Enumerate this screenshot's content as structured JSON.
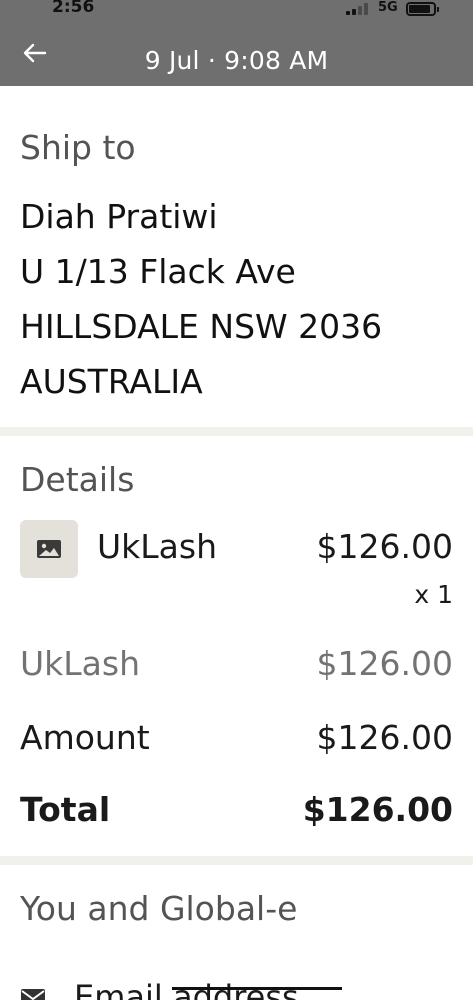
{
  "status_bar": {
    "time": "2:56",
    "network": "5G"
  },
  "header": {
    "title": "9 Jul · 9:08 AM"
  },
  "ship_to": {
    "heading": "Ship to",
    "lines": [
      "Diah Pratiwi",
      "U 1/13 Flack Ave",
      "HILLSDALE NSW 2036",
      "AUSTRALIA"
    ]
  },
  "details": {
    "heading": "Details",
    "item": {
      "name": "UkLash",
      "price": "$126.00",
      "quantity": "x 1",
      "icon": "image-icon"
    },
    "subtotal": {
      "label": "UkLash",
      "value": "$126.00"
    },
    "amount": {
      "label": "Amount",
      "value": "$126.00"
    },
    "total": {
      "label": "Total",
      "value": "$126.00"
    }
  },
  "merchant": {
    "heading": "You and Global-e",
    "email_label": "Email address"
  },
  "colors": {
    "header_bg": "#6f6f6f",
    "separator": "#f1f0ea",
    "muted_text": "#737373",
    "thumb_bg": "#e3e1da"
  }
}
